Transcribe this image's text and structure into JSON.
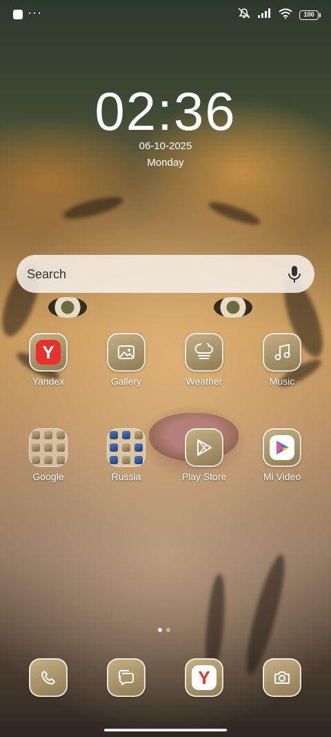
{
  "status_bar": {
    "left_icons": [
      "notification-square-icon",
      "more-dots-icon"
    ],
    "dots": "···",
    "right_icons": [
      "mute-icon",
      "signal-icon",
      "wifi-icon",
      "battery-icon"
    ],
    "battery": "100"
  },
  "lockscreen": {
    "time": "02:36",
    "date": "06-10-2025",
    "weekday": "Monday"
  },
  "search": {
    "placeholder": "Search"
  },
  "apps_row1": [
    {
      "label": "Yandex",
      "icon": "yandex-icon"
    },
    {
      "label": "Gallery",
      "icon": "gallery-icon"
    },
    {
      "label": "Weather",
      "icon": "weather-icon"
    },
    {
      "label": "Music",
      "icon": "music-icon"
    }
  ],
  "apps_row2": [
    {
      "label": "Google",
      "icon": "folder-icon"
    },
    {
      "label": "Russia",
      "icon": "folder-icon"
    },
    {
      "label": "Play Store",
      "icon": "play-store-icon"
    },
    {
      "label": "Mi Video",
      "icon": "mi-video-icon"
    }
  ],
  "dock": [
    {
      "icon": "phone-icon"
    },
    {
      "icon": "messages-icon"
    },
    {
      "icon": "yandex-browser-icon"
    },
    {
      "icon": "camera-icon"
    }
  ],
  "yandex_letter": "Y",
  "page_indicator": {
    "pages": 2,
    "current": 1
  },
  "colors": {
    "accent_yandex": "#e7312a",
    "tile_gold": "#b09a6c"
  }
}
